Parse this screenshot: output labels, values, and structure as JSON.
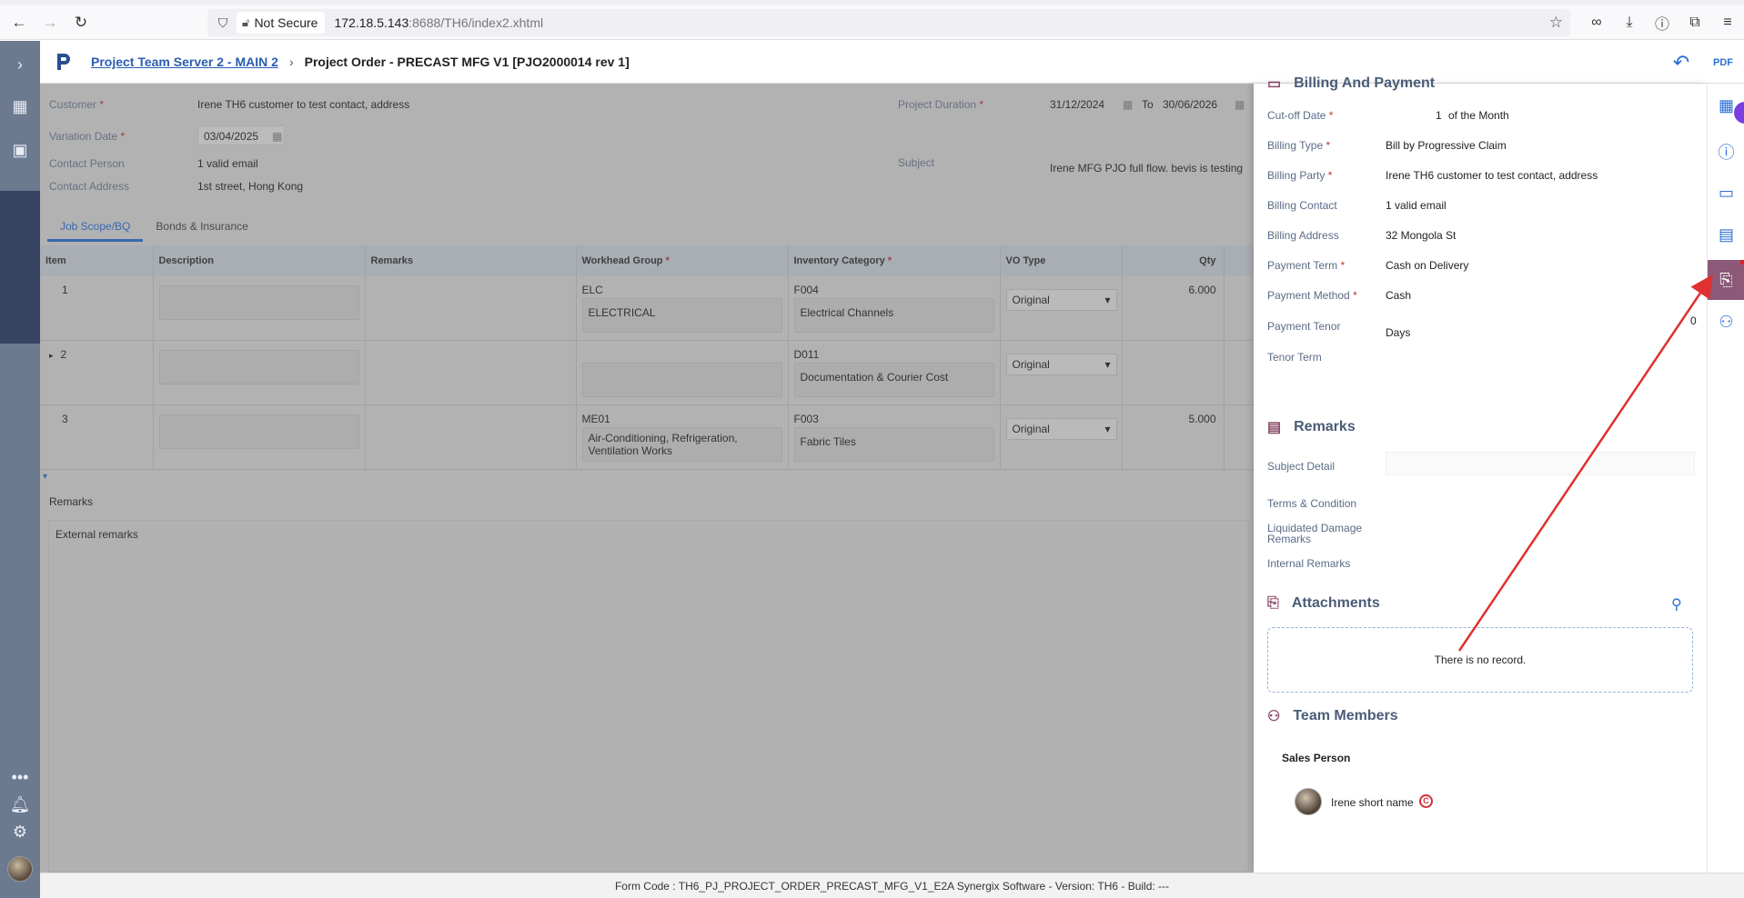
{
  "browser": {
    "security_label": "Not Secure",
    "url_host": "172.18.5.143",
    "url_rest": ":8688/TH6/index2.xhtml"
  },
  "header": {
    "breadcrumb_link": "Project Team Server 2 - MAIN 2",
    "page_title": "Project Order - PRECAST MFG V1 [PJO2000014 rev 1]",
    "pdf_label": "PDF"
  },
  "form": {
    "customer_label": "Customer",
    "customer_value": "Irene TH6 customer to test contact, address",
    "variation_date_label": "Variation Date",
    "variation_date_value": "03/04/2025",
    "contact_person_label": "Contact Person",
    "contact_person_value": "1 valid email",
    "contact_address_label": "Contact Address",
    "contact_address_value": "1st street, Hong Kong",
    "project_duration_label": "Project Duration",
    "duration_from": "31/12/2024",
    "duration_to_label": "To",
    "duration_to": "30/06/2026",
    "subject_label": "Subject",
    "subject_value": "Irene MFG PJO full flow. bevis is testing"
  },
  "tabs": [
    {
      "label": "Job Scope/BQ"
    },
    {
      "label": "Bonds & Insurance"
    }
  ],
  "grid": {
    "columns": [
      "Item",
      "Description",
      "Remarks",
      "Workhead Group",
      "Inventory Category",
      "VO Type",
      "Qty"
    ],
    "rows": [
      {
        "item": "1",
        "wh_code": "ELC",
        "wh_name": "ELECTRICAL",
        "inv_code": "F004",
        "inv_name": "Electrical Channels",
        "vo_type": "Original",
        "qty": "6.000"
      },
      {
        "item": "2",
        "wh_code": "",
        "wh_name": "",
        "inv_code": "D011",
        "inv_name": "Documentation & Courier Cost",
        "vo_type": "Original",
        "qty": ""
      },
      {
        "item": "3",
        "wh_code": "ME01",
        "wh_name": "Air-Conditioning, Refrigeration, Ventilation Works",
        "inv_code": "F003",
        "inv_name": "Fabric Tiles",
        "vo_type": "Original",
        "qty": "5.000"
      }
    ]
  },
  "remarks": {
    "label": "Remarks",
    "external": "External remarks"
  },
  "panel": {
    "billing_title": "Billing And Payment",
    "cutoff_label": "Cut-off Date",
    "cutoff_day": "1",
    "cutoff_suffix": "of the Month",
    "billing_type_label": "Billing Type",
    "billing_type_value": "Bill by Progressive Claim",
    "billing_party_label": "Billing Party",
    "billing_party_value": "Irene TH6 customer to test contact, address",
    "billing_contact_label": "Billing Contact",
    "billing_contact_value": "1 valid email",
    "billing_address_label": "Billing Address",
    "billing_address_value": "32 Mongola St",
    "payment_term_label": "Payment Term",
    "payment_term_value": "Cash on Delivery",
    "payment_method_label": "Payment Method",
    "payment_method_value": "Cash",
    "payment_tenor_label": "Payment Tenor",
    "payment_tenor_value": "0",
    "payment_tenor_unit": "Days",
    "tenor_term_label": "Tenor Term",
    "remarks_title": "Remarks",
    "subject_detail_label": "Subject Detail",
    "terms_label": "Terms & Condition",
    "ld_label": "Liquidated Damage Remarks",
    "internal_label": "Internal Remarks",
    "attachments_title": "Attachments",
    "no_record": "There is no record.",
    "team_title": "Team Members",
    "sales_person_label": "Sales Person",
    "member_name": "Irene short name"
  },
  "footer": {
    "text": "Form Code : TH6_PJ_PROJECT_ORDER_PRECAST_MFG_V1_E2A    Synergix Software - Version: TH6 - Build: ---"
  },
  "colors": {
    "accent": "#2a6fd6",
    "nav": "#6c7a90",
    "nav_active": "#364462",
    "panel_active": "#8c5a78",
    "arrow": "#e03030"
  }
}
